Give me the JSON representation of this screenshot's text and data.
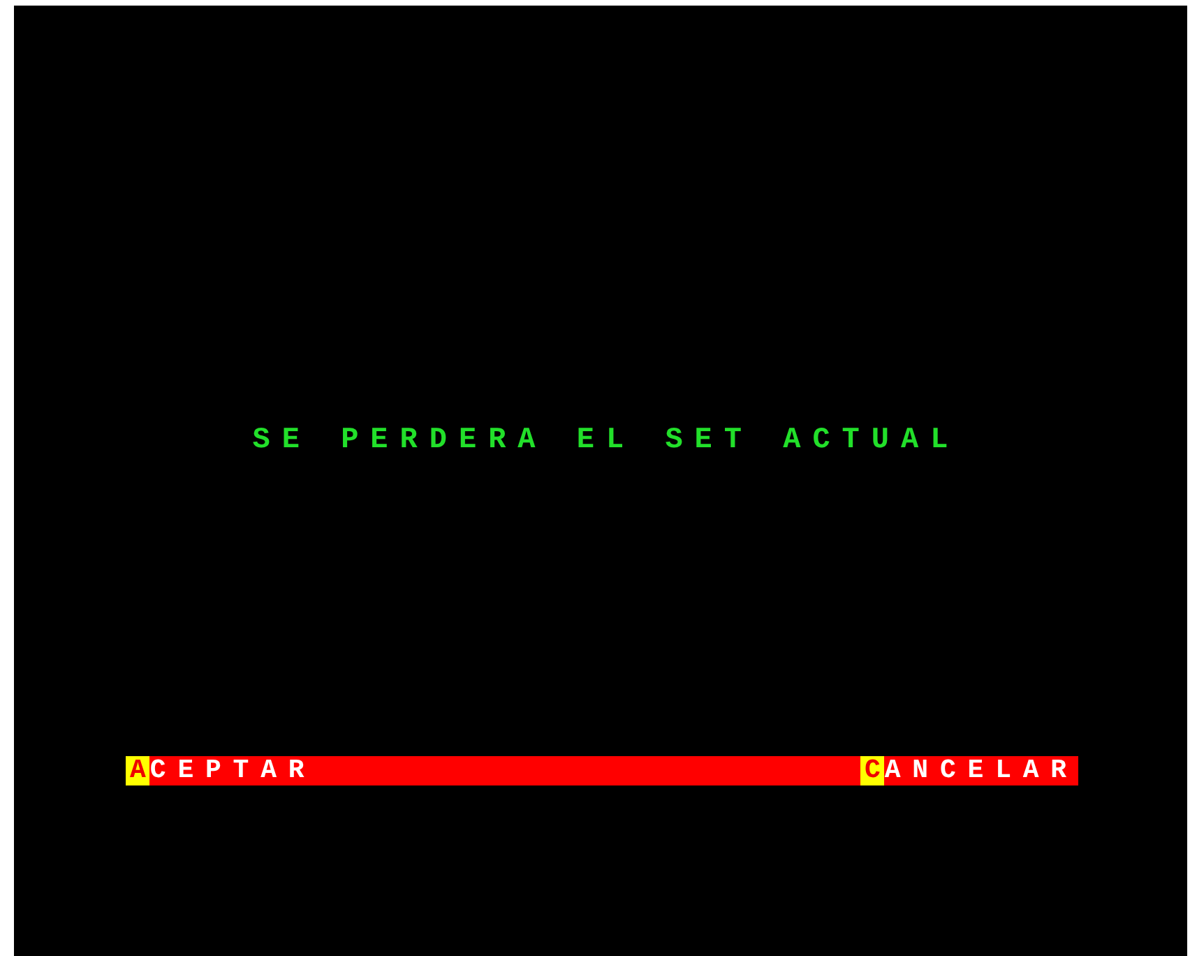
{
  "message": "SE PERDERA EL SET ACTUAL",
  "buttons": [
    {
      "hotkey": "A",
      "label": "CEPTAR"
    },
    {
      "hotkey": "C",
      "label": "ANCELAR"
    }
  ]
}
